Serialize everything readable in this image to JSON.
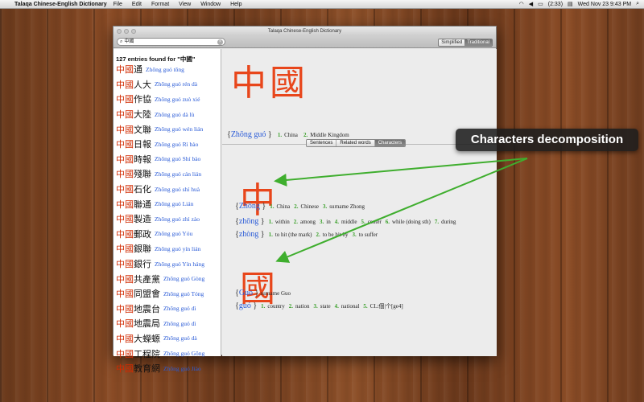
{
  "menubar": {
    "app_name": "Talaqa Chinese-English Dictionary",
    "menus": [
      "File",
      "Edit",
      "Format",
      "View",
      "Window",
      "Help"
    ],
    "battery": "(2:33)",
    "clock": "Wed Nov 23  9:43 PM"
  },
  "window": {
    "title": "Talaqa Chinese-English Dictionary",
    "search": {
      "value": "中國"
    },
    "script_toggle": {
      "options": [
        "Simplified",
        "Traditional"
      ],
      "selected": "Traditional"
    }
  },
  "results": {
    "count_label": "127 entries found for \"中國\"",
    "entries": [
      {
        "prefix": "中國",
        "rest": "通",
        "pinyin": "Zhōng guó tōng"
      },
      {
        "prefix": "中國",
        "rest": "人大",
        "pinyin": "Zhōng guó rén dà"
      },
      {
        "prefix": "中國",
        "rest": "作協",
        "pinyin": "Zhōng guó zuò xié"
      },
      {
        "prefix": "中國",
        "rest": "大陸",
        "pinyin": "Zhōng guó dà lù"
      },
      {
        "prefix": "中國",
        "rest": "文聯",
        "pinyin": "Zhōng guó wén lián"
      },
      {
        "prefix": "中國",
        "rest": "日報",
        "pinyin": "Zhōng guó Rì bào"
      },
      {
        "prefix": "中國",
        "rest": "時報",
        "pinyin": "Zhōng guó Shí bào"
      },
      {
        "prefix": "中國",
        "rest": "殘聯",
        "pinyin": "Zhōng guó cán lián"
      },
      {
        "prefix": "中國",
        "rest": "石化",
        "pinyin": "Zhōng guó shí huà"
      },
      {
        "prefix": "中國",
        "rest": "聯通",
        "pinyin": "Zhōng guó Lián"
      },
      {
        "prefix": "中國",
        "rest": "製造",
        "pinyin": "Zhōng guó zhì zào"
      },
      {
        "prefix": "中國",
        "rest": "郵政",
        "pinyin": "Zhōng guó Yóu"
      },
      {
        "prefix": "中國",
        "rest": "銀聯",
        "pinyin": "Zhōng guó yín lián"
      },
      {
        "prefix": "中國",
        "rest": "銀行",
        "pinyin": "Zhōng guó Yín háng"
      },
      {
        "prefix": "中國",
        "rest": "共產黨",
        "pinyin": "Zhōng guó Gòng"
      },
      {
        "prefix": "中國",
        "rest": "同盟會",
        "pinyin": "Zhōng guó Tóng"
      },
      {
        "prefix": "中國",
        "rest": "地震台",
        "pinyin": "Zhōng guó dì"
      },
      {
        "prefix": "中國",
        "rest": "地震局",
        "pinyin": "Zhōng guó dì"
      },
      {
        "prefix": "中國",
        "rest": "大蠑螈",
        "pinyin": "Zhōng guó dà"
      },
      {
        "prefix": "中國",
        "rest": "工程院",
        "pinyin": "Zhōng guó Gōng"
      },
      {
        "prefix": "中國",
        "rest": "教育網",
        "pinyin": "Zhōng guó Jiào"
      }
    ]
  },
  "detail": {
    "headword": "中國",
    "headword_entry": {
      "pinyin": "Zhōng guó",
      "senses": [
        {
          "num": "1.",
          "text": "China"
        },
        {
          "num": "2.",
          "text": "Middle Kingdom"
        }
      ]
    },
    "tabs": {
      "items": [
        "Sentences",
        "Related words",
        "Characters"
      ],
      "selected": "Characters"
    },
    "characters": [
      {
        "char": "中",
        "readings": [
          {
            "pinyin": "Zhōng",
            "senses": [
              {
                "num": "1.",
                "text": "China"
              },
              {
                "num": "2.",
                "text": "Chinese"
              },
              {
                "num": "3.",
                "text": "surname Zhong"
              }
            ]
          },
          {
            "pinyin": "zhōng",
            "senses": [
              {
                "num": "1.",
                "text": "within"
              },
              {
                "num": "2.",
                "text": "among"
              },
              {
                "num": "3.",
                "text": "in"
              },
              {
                "num": "4.",
                "text": "middle"
              },
              {
                "num": "5.",
                "text": "center"
              },
              {
                "num": "6.",
                "text": "while (doing sth)"
              },
              {
                "num": "7.",
                "text": "during"
              }
            ]
          },
          {
            "pinyin": "zhòng",
            "senses": [
              {
                "num": "1.",
                "text": "to hit (the mark)"
              },
              {
                "num": "2.",
                "text": "to be hit by"
              },
              {
                "num": "3.",
                "text": "to suffer"
              }
            ]
          }
        ]
      },
      {
        "char": "國",
        "readings": [
          {
            "pinyin": "Guó",
            "senses": [
              {
                "num": "",
                "text": "surname Guo"
              }
            ]
          },
          {
            "pinyin": "guó",
            "senses": [
              {
                "num": "1.",
                "text": "country"
              },
              {
                "num": "2.",
                "text": "nation"
              },
              {
                "num": "3.",
                "text": "state"
              },
              {
                "num": "4.",
                "text": "national"
              },
              {
                "num": "5.",
                "text": "CL:個|个[ge4]"
              }
            ]
          }
        ]
      }
    ]
  },
  "callout": {
    "text": "Characters decomposition"
  },
  "colors": {
    "hanzi_red": "#e8461b",
    "pinyin_blue": "#2a5bd7",
    "sense_num_green": "#3aa02a",
    "arrow_green": "#3fae2e"
  }
}
